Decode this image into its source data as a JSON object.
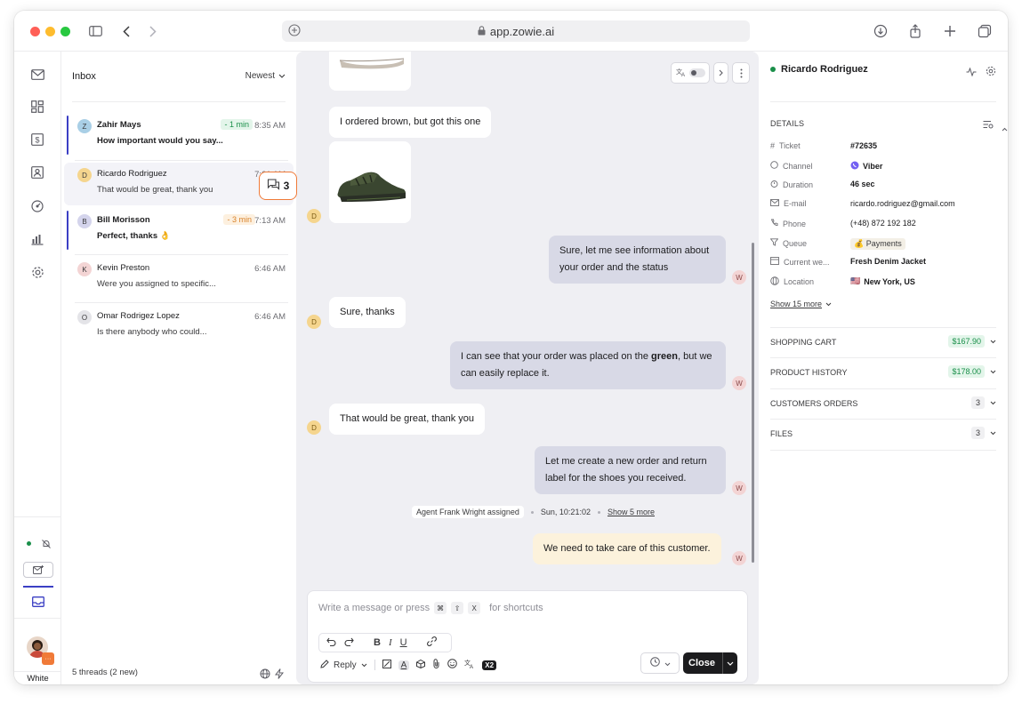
{
  "browser": {
    "url": "app.zowie.ai"
  },
  "rail": {
    "user_label": "White"
  },
  "inbox": {
    "title": "Inbox",
    "sort_label": "Newest",
    "footer": "5 threads (2 new)",
    "threads": [
      {
        "initial": "Z",
        "name": "Zahir Mays",
        "preview": "How important would you say...",
        "time": "8:35 AM",
        "badge": "- 1 min",
        "avatar_color": "#a9cfe6"
      },
      {
        "initial": "D",
        "name": "Ricardo Rodriguez",
        "preview": "That would be great, thank you",
        "time": "7:21 AM",
        "avatar_color": "#f5d58e"
      },
      {
        "initial": "B",
        "name": "Bill Morisson",
        "preview": "Perfect, thanks 👌",
        "time": "7:13 AM",
        "badge": "- 3 min",
        "avatar_color": "#d4d4ec"
      },
      {
        "initial": "K",
        "name": "Kevin Preston",
        "preview": "Were you assigned to specific...",
        "time": "6:46 AM",
        "avatar_color": "#f3d4d4"
      },
      {
        "initial": "O",
        "name": "Omar Rodrigez Lopez",
        "preview": "Is there anybody who could...",
        "time": "6:46 AM",
        "avatar_color": "#e4e4e8"
      }
    ],
    "float_count": "3"
  },
  "chat": {
    "messages": [
      {
        "text": "I ordered brown, but got this one"
      },
      {
        "text": "Sure, let me see information about your order and the status"
      },
      {
        "text": "Sure, thanks"
      },
      {
        "pre": "I can see that your order was placed on the ",
        "bold": "green",
        "post": ", but we can easily replace it."
      },
      {
        "text": "That would be great, thank you"
      },
      {
        "text": "Let me create a new order and return label for the shoes you received."
      },
      {
        "text": "We need to take care of this customer."
      }
    ],
    "customer_initial": "D",
    "agent_initial": "W",
    "system": {
      "assigned": "Agent Frank Wright assigned",
      "time": "Sun, 10:21:02",
      "more": "Show 5 more"
    },
    "composer": {
      "placeholder": "Write a message or press",
      "placeholder_tail": "for shortcuts",
      "keys": [
        "⌘",
        "⇧",
        "X"
      ],
      "reply_label": "Reply",
      "close_label": "Close",
      "x2_label": "X2"
    }
  },
  "panel": {
    "customer_name": "Ricardo Rodriguez",
    "details_title": "DETAILS",
    "details": [
      {
        "key": "Ticket",
        "value": "#72635"
      },
      {
        "key": "Channel",
        "value": "Viber"
      },
      {
        "key": "Duration",
        "value": "46 sec"
      },
      {
        "key": "E-mail",
        "value": "ricardo.rodriguez@gmail.com"
      },
      {
        "key": "Phone",
        "value": "(+48) 872 192 182"
      },
      {
        "key": "Queue",
        "value": "Payments"
      },
      {
        "key": "Current we...",
        "value": "Fresh Denim Jacket"
      },
      {
        "key": "Location",
        "value": "New York, US"
      }
    ],
    "show_more": "Show 15 more",
    "sections": [
      {
        "title": "SHOPPING CART",
        "amount": "$167.90"
      },
      {
        "title": "PRODUCT HISTORY",
        "amount": "$178.00"
      },
      {
        "title": "CUSTOMERS ORDERS",
        "count": "3"
      },
      {
        "title": "FILES",
        "count": "3"
      }
    ]
  },
  "colors": {
    "accent": "#3b3fc4",
    "highlight": "#f07a38",
    "online": "#1a8f4a"
  }
}
